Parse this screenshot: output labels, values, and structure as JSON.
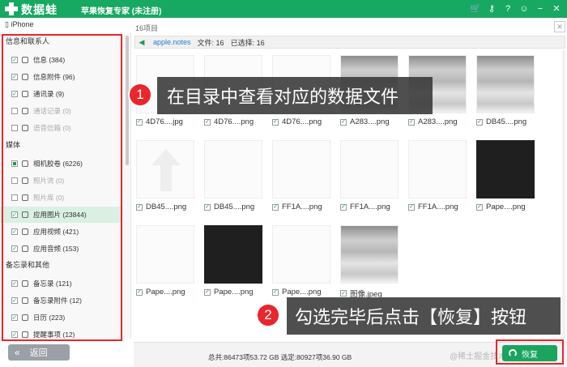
{
  "window": {
    "brand": "数据蛙",
    "title": "苹果恢复专家 (未注册)",
    "icons": [
      "cart-icon",
      "key-icon",
      "help-icon",
      "chat-icon",
      "minimize-icon",
      "close-icon"
    ]
  },
  "sidebar": {
    "device": "iPhone",
    "sections": [
      {
        "title": "信息和联系人",
        "items": [
          {
            "label": "信息 (384)",
            "checked": true
          },
          {
            "label": "信息附件 (96)",
            "checked": true
          },
          {
            "label": "通讯录 (9)",
            "checked": true
          },
          {
            "label": "通话记录 (0)",
            "checked": false,
            "dim": true
          },
          {
            "label": "语音信箱 (0)",
            "checked": false,
            "dim": true
          }
        ]
      },
      {
        "title": "媒体",
        "items": [
          {
            "label": "相机胶卷 (6226)",
            "checked": "partial"
          },
          {
            "label": "照片流 (0)",
            "checked": false,
            "dim": true
          },
          {
            "label": "照片库 (0)",
            "checked": false,
            "dim": true
          },
          {
            "label": "应用图片 (23844)",
            "checked": true,
            "selected": true
          },
          {
            "label": "应用视频 (421)",
            "checked": true
          },
          {
            "label": "应用音频 (153)",
            "checked": true
          }
        ]
      },
      {
        "title": "备忘录和其他",
        "items": [
          {
            "label": "备忘录 (121)",
            "checked": true
          },
          {
            "label": "备忘录附件 (12)",
            "checked": true
          },
          {
            "label": "日历 (223)",
            "checked": true
          },
          {
            "label": "提醒事项 (12)",
            "checked": true
          }
        ]
      }
    ],
    "back_label": "返回"
  },
  "main": {
    "count_label": "16项目",
    "path": "apple.notes",
    "files_stat": "文件: 16",
    "selected_stat": "已选择: 16",
    "files": [
      {
        "name": "4D76....jpg",
        "kind": "white"
      },
      {
        "name": "4D76....png",
        "kind": "white"
      },
      {
        "name": "4D76....png",
        "kind": "white"
      },
      {
        "name": "A283....png",
        "kind": "blur"
      },
      {
        "name": "A283....png",
        "kind": "blur"
      },
      {
        "name": "DB45....png",
        "kind": "blur"
      },
      {
        "name": "DB45....png",
        "kind": "arrow"
      },
      {
        "name": "DB45....png",
        "kind": "white"
      },
      {
        "name": "FF1A....png",
        "kind": "white"
      },
      {
        "name": "FF1A....png",
        "kind": "white"
      },
      {
        "name": "FF1A....png",
        "kind": "white"
      },
      {
        "name": "Pape....png",
        "kind": "black"
      },
      {
        "name": "Pape....png",
        "kind": "white"
      },
      {
        "name": "Pape....png",
        "kind": "black"
      },
      {
        "name": "Pape....png",
        "kind": "white"
      },
      {
        "name": "图像.jpeg",
        "kind": "blur"
      }
    ]
  },
  "footer": {
    "summary": "总共:86473项53.72 GB 选定:80927项36.90 GB",
    "recover_label": "恢复",
    "watermark": "@稀土掘金技术社区"
  },
  "callouts": [
    {
      "num": "1",
      "text": "在目录中查看对应的数据文件"
    },
    {
      "num": "2",
      "text": "勾选完毕后点击【恢复】按钮"
    }
  ]
}
